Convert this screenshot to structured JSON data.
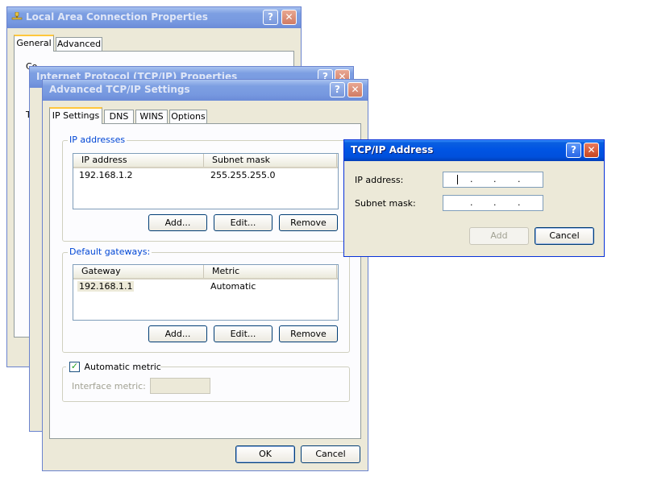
{
  "lac": {
    "title": "Local Area Connection Properties",
    "tabs": [
      "General",
      "Advanced"
    ],
    "peek": {
      "connect": "Co",
      "this": "T"
    }
  },
  "tcpip": {
    "title": "Internet Protocol (TCP/IP) Properties"
  },
  "adv": {
    "title": "Advanced TCP/IP Settings",
    "tabs": [
      "IP Settings",
      "DNS",
      "WINS",
      "Options"
    ],
    "ip_group": "IP addresses",
    "ip_cols": [
      "IP address",
      "Subnet mask"
    ],
    "ip_rows": [
      {
        "ip": "192.168.1.2",
        "mask": "255.255.255.0"
      }
    ],
    "gw_group": "Default gateways:",
    "gw_cols": [
      "Gateway",
      "Metric"
    ],
    "gw_rows": [
      {
        "gateway": "192.168.1.1",
        "metric": "Automatic"
      }
    ],
    "add_label": "Add...",
    "edit_label": "Edit...",
    "remove_label": "Remove",
    "auto_metric_label": "Automatic metric",
    "auto_metric_checked": true,
    "interface_metric_label": "Interface metric:",
    "ok_label": "OK",
    "cancel_label": "Cancel"
  },
  "ipdlg": {
    "title": "TCP/IP Address",
    "ip_label": "IP address:",
    "mask_label": "Subnet mask:",
    "add_label": "Add",
    "cancel_label": "Cancel"
  },
  "icons": {
    "help": "?",
    "close": "✕",
    "check": "✓",
    "ip_dot": "."
  },
  "colors": {
    "title_active": "#0054e3",
    "title_inactive": "#7d9fe2",
    "group_label": "#0046d5",
    "face": "#ece9d8"
  }
}
